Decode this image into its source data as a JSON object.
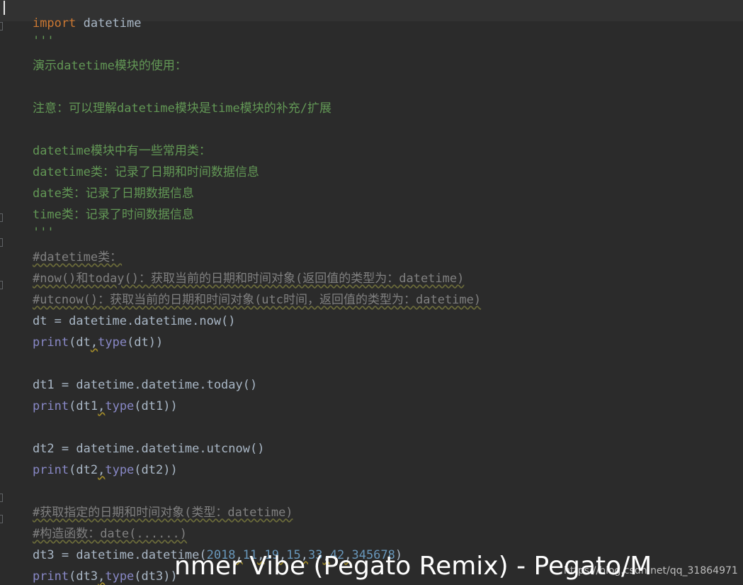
{
  "code": {
    "l1": {
      "kw": "import",
      "rest": " datetime"
    },
    "l2": "'''",
    "l3": "演示datetime模块的使用：",
    "l5": "注意：可以理解datetime模块是time模块的补充/扩展",
    "l7": "datetime模块中有一些常用类：",
    "l8": "datetime类：记录了日期和时间数据信息",
    "l9": "date类：记录了日期数据信息",
    "l10": "time类：记录了时间数据信息",
    "l11": "'''",
    "l12": "#datetime类：",
    "l13": "#now()和today()：获取当前的日期和时间对象(返回值的类型为：datetime)",
    "l14": "#utcnow()：获取当前的日期和时间对象(utc时间，返回值的类型为：datetime)",
    "l15": "dt = datetime.datetime.now()",
    "l16": {
      "fn": "print",
      "a": "(dt",
      "comma": ",",
      "fn2": "type",
      "b": "(dt))"
    },
    "l18": "dt1 = datetime.datetime.today()",
    "l19": {
      "fn": "print",
      "a": "(dt1",
      "comma": ",",
      "fn2": "type",
      "b": "(dt1))"
    },
    "l21": "dt2 = datetime.datetime.utcnow()",
    "l22": {
      "fn": "print",
      "a": "(dt2",
      "comma": ",",
      "fn2": "type",
      "b": "(dt2))"
    },
    "l24": "#获取指定的日期和时间对象(类型：datetime)",
    "l25": "#构造函数：date(......)",
    "l26": {
      "head": "dt3 = datetime.datetime(",
      "n1": "2018",
      "n2": "11",
      "n3": "19",
      "n4": "15",
      "n5": "33",
      "n6": "42",
      "n7": "345678",
      "comma": ",",
      "tail": ")"
    },
    "l27": {
      "fn": "print",
      "a": "(dt3",
      "comma": ",",
      "fn2": "type",
      "b": "(dt3))"
    }
  },
  "overlay": {
    "title": "nmer Vibe (Pegato Remix) - Pegato/M",
    "watermark": "https://blog.csdn.net/qq_31864971"
  },
  "colors": {
    "background": "#2b2b2b",
    "keyword": "#cc7832",
    "docstring": "#629755",
    "comment": "#808080",
    "builtin": "#8888c6",
    "number": "#6897bb",
    "text": "#a9b7c6"
  }
}
